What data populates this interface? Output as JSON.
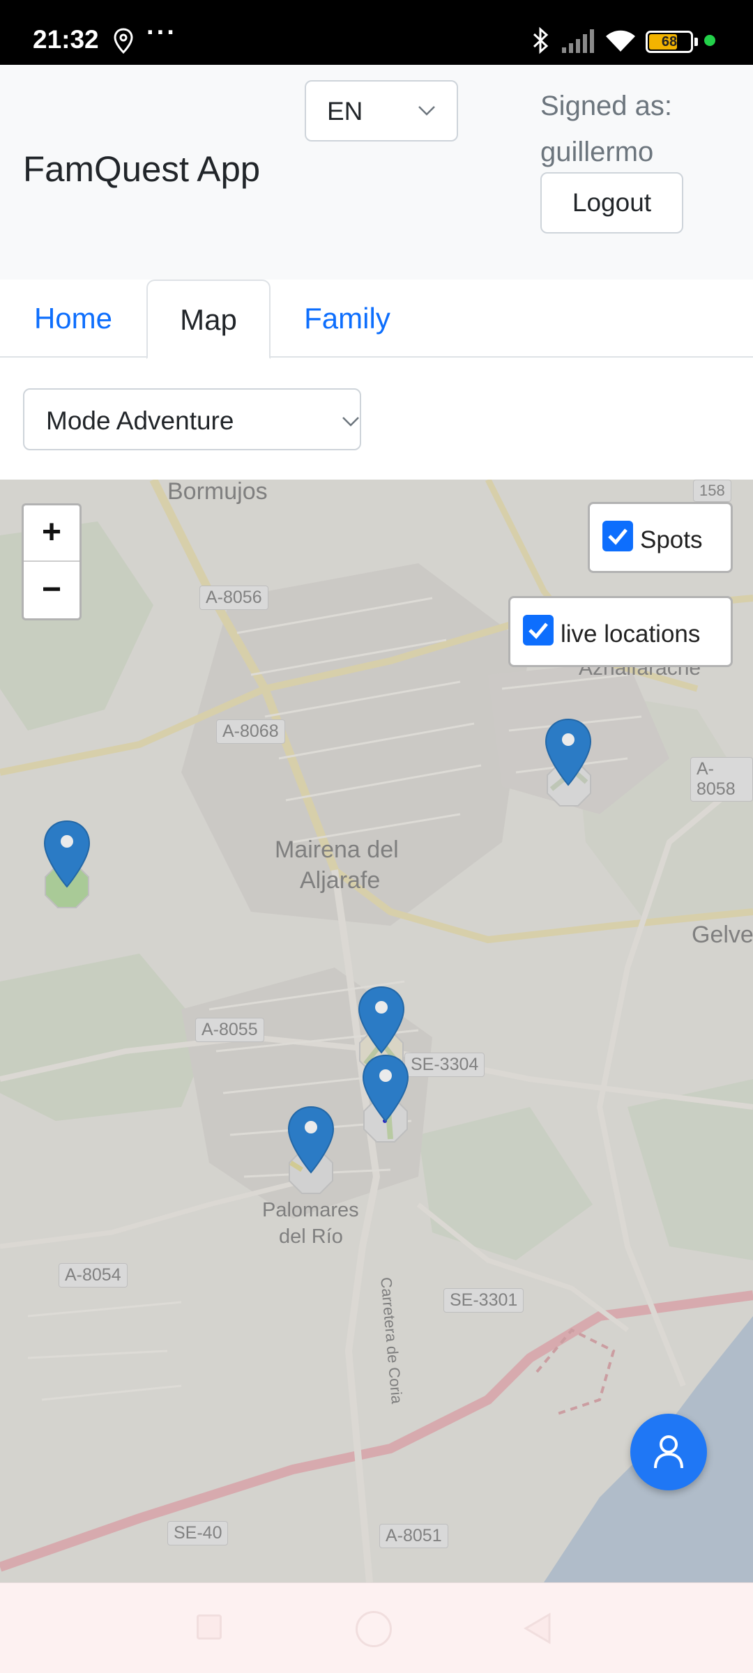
{
  "status_bar": {
    "time": "21:32",
    "more_indicator": "···",
    "battery_percent": "68",
    "icons": [
      "location-pin-icon",
      "bluetooth-icon",
      "signal-icon",
      "wifi-icon",
      "battery-icon"
    ]
  },
  "header": {
    "app_title": "FamQuest App",
    "language": {
      "selected": "EN"
    },
    "signed_as_label": "Signed as:",
    "username": "guillermo",
    "logout_label": "Logout"
  },
  "tabs": [
    {
      "label": "Home",
      "active": false
    },
    {
      "label": "Map",
      "active": true
    },
    {
      "label": "Family",
      "active": false
    }
  ],
  "mode": {
    "selected": "Mode Adventure"
  },
  "map": {
    "zoom_in": "+",
    "zoom_out": "−",
    "layers": {
      "spots": {
        "label": "Spots",
        "checked": true
      },
      "live_locations": {
        "label": "live locations",
        "checked": true
      }
    },
    "place_labels": [
      "Bormujos",
      "Mairena del",
      "Aljarafe",
      "Palomares",
      "del Río",
      "Azhalfarache",
      "Gelve",
      "Carretera de Coria"
    ],
    "road_labels": [
      "A-8056",
      "A-8068",
      "A-8055",
      "SE-3304",
      "A-8054",
      "SE-3301",
      "SE-40",
      "A-8051",
      "A-8058",
      "158"
    ],
    "marker_count": 5
  },
  "colors": {
    "accent": "#0d6efd",
    "fab": "#1f77f5",
    "marker": "#2f86d6",
    "header_bg": "#f8f9fa"
  },
  "fab": {
    "icon": "person-icon"
  }
}
